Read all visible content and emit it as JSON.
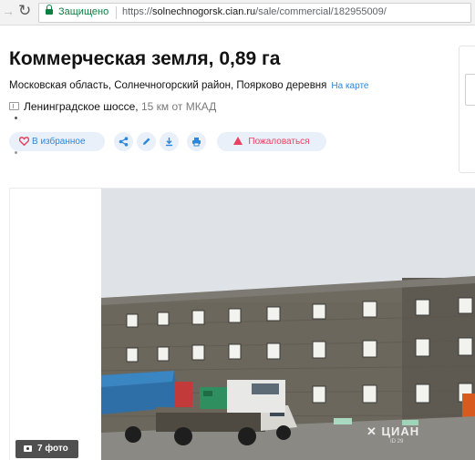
{
  "browser": {
    "security_label": "Защищено",
    "url_scheme": "https://",
    "url_host": "solnechnogorsk.cian.ru",
    "url_path": "/sale/commercial/182955009/"
  },
  "listing": {
    "title": "Коммерческая земля, 0,89 га",
    "address": "Московская область, Солнечногорский район, Поярково деревня",
    "map_link": "На карте",
    "highway": "Ленинградское шоссе,",
    "highway_distance": "15 км от МКАД"
  },
  "actions": {
    "favorite_label": "В избранное",
    "report_label": "Пожаловаться"
  },
  "gallery": {
    "photo_count_label": "7 фото",
    "watermark": "ЦИАН",
    "watermark_id": "ID 29",
    "photo_alt": "Трёхэтажное кирпичное здание, перед которым стоят грузовики"
  },
  "colors": {
    "accent": "#2b87db",
    "danger": "#e84260",
    "secure_green": "#0b8043"
  }
}
